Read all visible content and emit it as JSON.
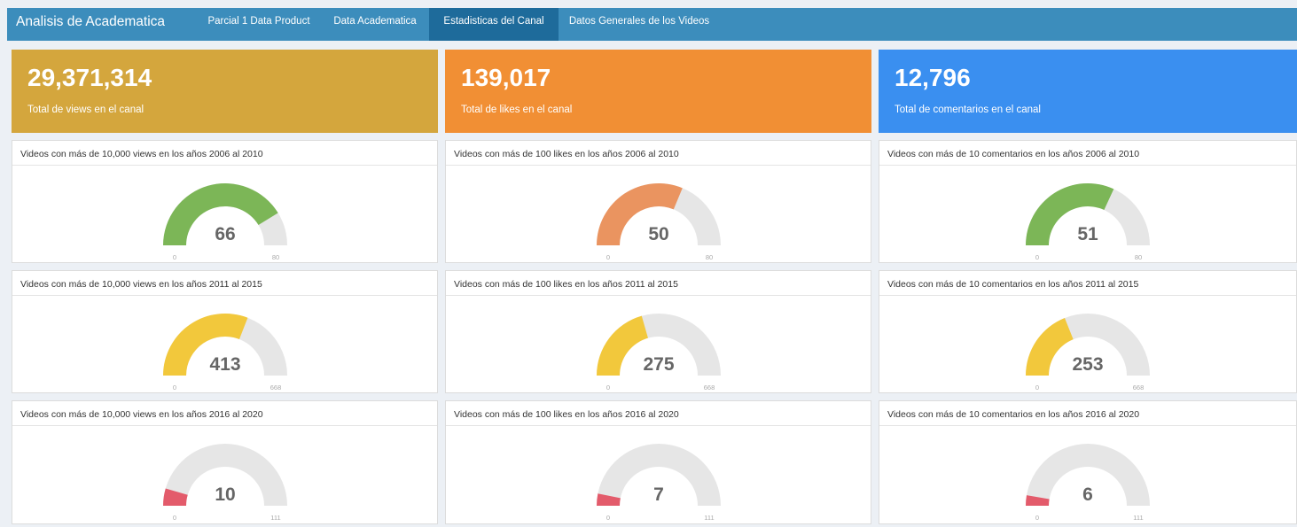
{
  "app": {
    "title": "Analisis de Academatica",
    "tabs": [
      {
        "label": "Parcial 1 Data Product",
        "active": false
      },
      {
        "label": "Data Academatica",
        "active": false
      },
      {
        "label": "Estadisticas del Canal",
        "active": true
      },
      {
        "label": "Datos Generales de los Videos",
        "active": false
      }
    ]
  },
  "value_boxes": [
    {
      "value": "29,371,314",
      "label": "Total de views en el canal",
      "color": "#d4a63d"
    },
    {
      "value": "139,017",
      "label": "Total de likes en el canal",
      "color": "#f18f34"
    },
    {
      "value": "12,796",
      "label": "Total de comentarios en el canal",
      "color": "#3a8ff0"
    }
  ],
  "colors": {
    "topbar": "#3c8dbc",
    "active_tab": "#1e6b9b",
    "gauge_track": "#e6e6e6",
    "green": "#7cb657",
    "orange": "#ea9460",
    "yellow": "#f2c83c",
    "red": "#e35b6b"
  },
  "gauges": [
    {
      "title": "Videos con más de 10,000 views en los años 2006 al 2010",
      "value": 66,
      "min": "0",
      "max": "80",
      "maxnum": 80,
      "color": "#7cb657"
    },
    {
      "title": "Videos con más de 100 likes en los años 2006 al 2010",
      "value": 50,
      "min": "0",
      "max": "80",
      "maxnum": 80,
      "color": "#ea9460"
    },
    {
      "title": "Videos con más de 10 comentarios en los años 2006 al 2010",
      "value": 51,
      "min": "0",
      "max": "80",
      "maxnum": 80,
      "color": "#7cb657"
    },
    {
      "title": "Videos con más de 10,000 views en los años 2011 al 2015",
      "value": 413,
      "min": "0",
      "max": "668",
      "maxnum": 668,
      "color": "#f2c83c"
    },
    {
      "title": "Videos con más de 100 likes en los años 2011 al 2015",
      "value": 275,
      "min": "0",
      "max": "668",
      "maxnum": 668,
      "color": "#f2c83c"
    },
    {
      "title": "Videos con más de 10 comentarios en los años 2011 al 2015",
      "value": 253,
      "min": "0",
      "max": "668",
      "maxnum": 668,
      "color": "#f2c83c"
    },
    {
      "title": "Videos con más de 10,000 views en los años 2016 al 2020",
      "value": 10,
      "min": "0",
      "max": "111",
      "maxnum": 111,
      "color": "#e35b6b"
    },
    {
      "title": "Videos con más de 100 likes en los años 2016 al 2020",
      "value": 7,
      "min": "0",
      "max": "111",
      "maxnum": 111,
      "color": "#e35b6b"
    },
    {
      "title": "Videos con más de 10 comentarios en los años 2016 al 2020",
      "value": 6,
      "min": "0",
      "max": "111",
      "maxnum": 111,
      "color": "#e35b6b"
    }
  ]
}
